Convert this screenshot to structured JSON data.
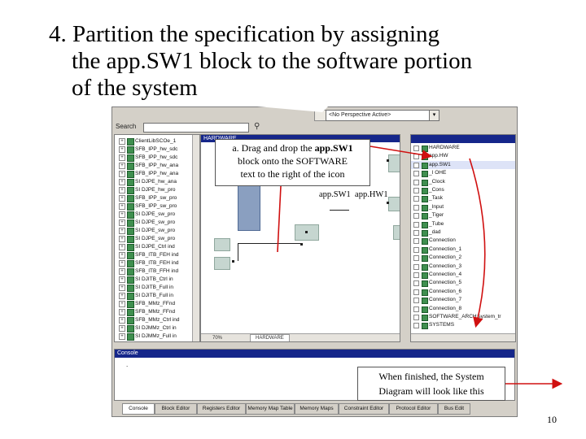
{
  "title": {
    "line1": "4. Partition the specification by assigning",
    "line2": "the app.SW1 block to the software portion",
    "line3": "of the system"
  },
  "toolbar": {
    "perspective_value": "<No Perspective Active>",
    "search_label": "Search",
    "search_value": ""
  },
  "left_tree": {
    "items": [
      "ClientLibSCOe_1",
      "SFB_IPP_hw_sdc",
      "SFB_IPP_hw_sdc",
      "SFB_IPP_hw_ana",
      "SFB_IPP_hw_ana",
      "SI DJPE_hw_ana",
      "SI DJPE_hw_pro",
      "SFB_IPP_sw_pro",
      "SFB_IPP_sw_pro",
      "SI DJPE_sw_pro",
      "SI DJPE_sw_pro",
      "SI DJPE_sw_pro",
      "SI DJPE_sw_pro",
      "SI DJPE_Ctrl ind",
      "SFB_ITB_FEH ind",
      "SFB_ITB_FEH ind",
      "SFB_ITB_FFH ind",
      "SI DJITB_Ctrl in",
      "SI DJITB_Full in",
      "SI DJITB_Full in",
      "SFB_MMz_FFnd",
      "SFB_MMz_FFnd",
      "SFB_MMz_Ctrl ind",
      "SI DJMMz_Ctrl in",
      "SI DJMMz_Full in"
    ]
  },
  "diagram": {
    "window_title": "HARDWARE",
    "zoom": "70%",
    "tab": "HARDWARE"
  },
  "right_tree": {
    "items": [
      "HARDWARE",
      "app.HW",
      "app.SW1",
      "_I OHE",
      "_Clock",
      "_Cons",
      "_Task",
      "_Input",
      "_Tiger",
      "_Tube",
      "_dad",
      "Connection",
      "Connection_1",
      "Connection_2",
      "Connection_3",
      "Connection_4",
      "Connection_5",
      "Connection_6",
      "Connection_7",
      "Connection_8",
      "SOFTWARE_ARCH:system_tr",
      "SYSTEMS"
    ],
    "selected_index": 2
  },
  "console": {
    "title": "Console",
    "content": "."
  },
  "bottom_tabs": [
    "Console",
    "Block Editor",
    "Registers Editor",
    "Memory Map Table",
    "Memory Maps",
    "Constraint Editor",
    "Protocol Editor",
    "Bus Edit"
  ],
  "active_tab_index": 0,
  "callouts": {
    "drag": {
      "prefix": "a. Drag and drop the ",
      "bold": "app.SW1",
      "line2": "block onto the SOFTWARE",
      "line3": "text to the right of the icon"
    },
    "finished": {
      "line1": "When finished, the System",
      "line2": "Diagram will look like this"
    }
  },
  "diagram_labels": {
    "sw": "app.SW1",
    "hw": "app.HW1"
  },
  "page_number": "10",
  "colors": {
    "arrow": "#d01010",
    "title_bar": "#15268a",
    "block": "#c6d6d0",
    "tree_icon": "#3f8f4f"
  }
}
